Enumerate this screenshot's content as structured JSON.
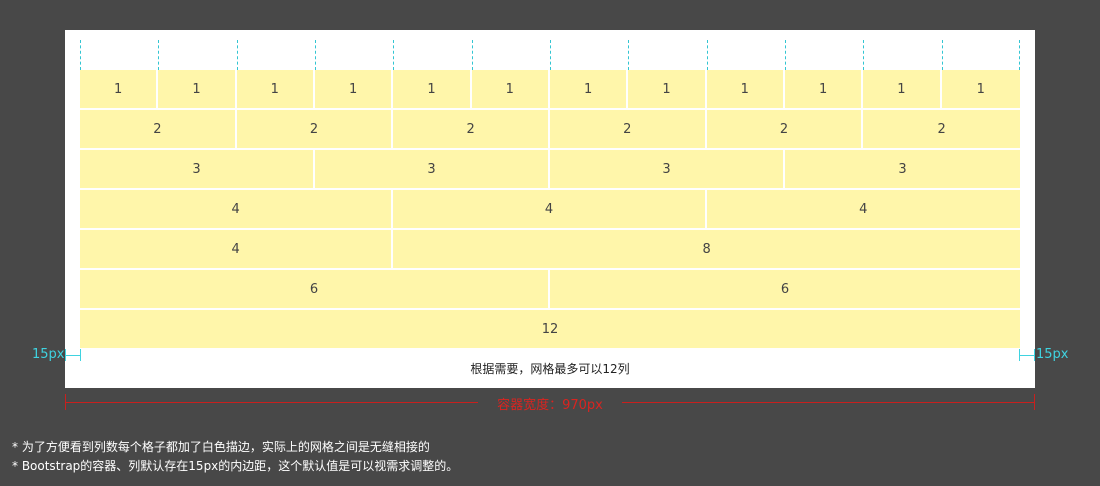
{
  "grid": {
    "total_columns": 12,
    "rows": [
      [
        1,
        1,
        1,
        1,
        1,
        1,
        1,
        1,
        1,
        1,
        1,
        1
      ],
      [
        2,
        2,
        2,
        2,
        2,
        2
      ],
      [
        3,
        3,
        3,
        3
      ],
      [
        4,
        4,
        4
      ],
      [
        4,
        8
      ],
      [
        6,
        6
      ],
      [
        12
      ]
    ]
  },
  "caption": "根据需要，网格最多可以12列",
  "padding": {
    "left_label": "15px",
    "right_label": "15px"
  },
  "container_width_label": "容器宽度：970px",
  "notes": [
    "* 为了方便看到列数每个格子都加了白色描边，实际上的网格之间是无缝相接的",
    "* Bootstrap的容器、列默认存在15px的内边距，这个默认值是可以视需求调整的。"
  ],
  "colors": {
    "background": "#484848",
    "container": "#ffffff",
    "cell": "#fff6aa",
    "guide": "#32c5d2",
    "padding_marker": "#3fd3e0",
    "width_marker": "#d92420"
  }
}
